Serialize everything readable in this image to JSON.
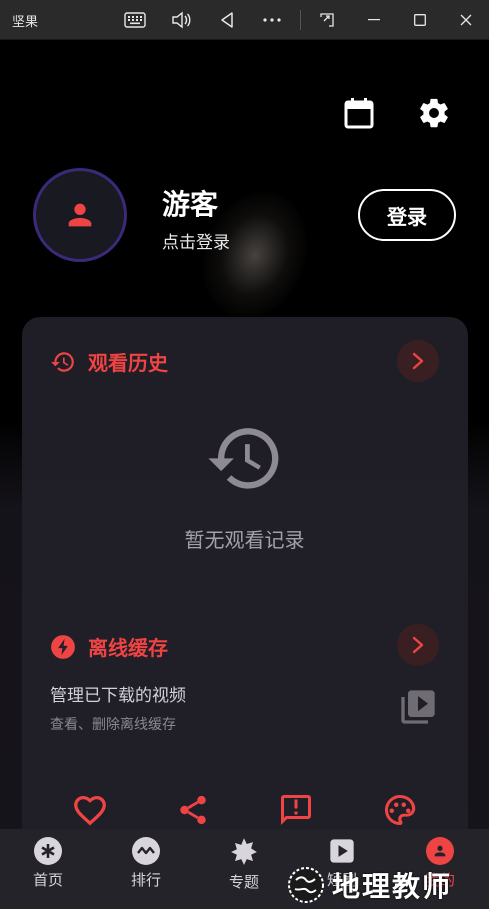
{
  "window": {
    "title": "坚果",
    "icons": [
      "keyboard-icon",
      "volume-icon",
      "back-triangle-icon",
      "more-icon",
      "window-snap-icon",
      "minimize-icon",
      "maximize-icon",
      "close-icon"
    ]
  },
  "header": {
    "icons": [
      "calendar-icon",
      "settings-gear-icon"
    ]
  },
  "profile": {
    "name": "游客",
    "subtitle": "点击登录",
    "login_label": "登录"
  },
  "history": {
    "title": "观看历史",
    "empty_text": "暂无观看记录",
    "icon": "history-icon"
  },
  "offline": {
    "title": "离线缓存",
    "item_title": "管理已下载的视频",
    "item_subtitle": "查看、删除离线缓存",
    "icon": "bolt-icon"
  },
  "actions": [
    "heart-icon",
    "share-icon",
    "feedback-icon",
    "palette-icon"
  ],
  "nav": {
    "items": [
      {
        "label": "首页",
        "icon": "asterisk-icon"
      },
      {
        "label": "排行",
        "icon": "wave-icon"
      },
      {
        "label": "专题",
        "icon": "burst-icon"
      },
      {
        "label": "短剧",
        "icon": "play-icon"
      },
      {
        "label": "我的",
        "icon": "person-icon"
      }
    ],
    "active_index": 4
  },
  "watermark": {
    "text": "地理教师"
  },
  "colors": {
    "accent": "#ef4444",
    "background": "#000000",
    "card": "#221f28",
    "nav": "#25232a"
  }
}
